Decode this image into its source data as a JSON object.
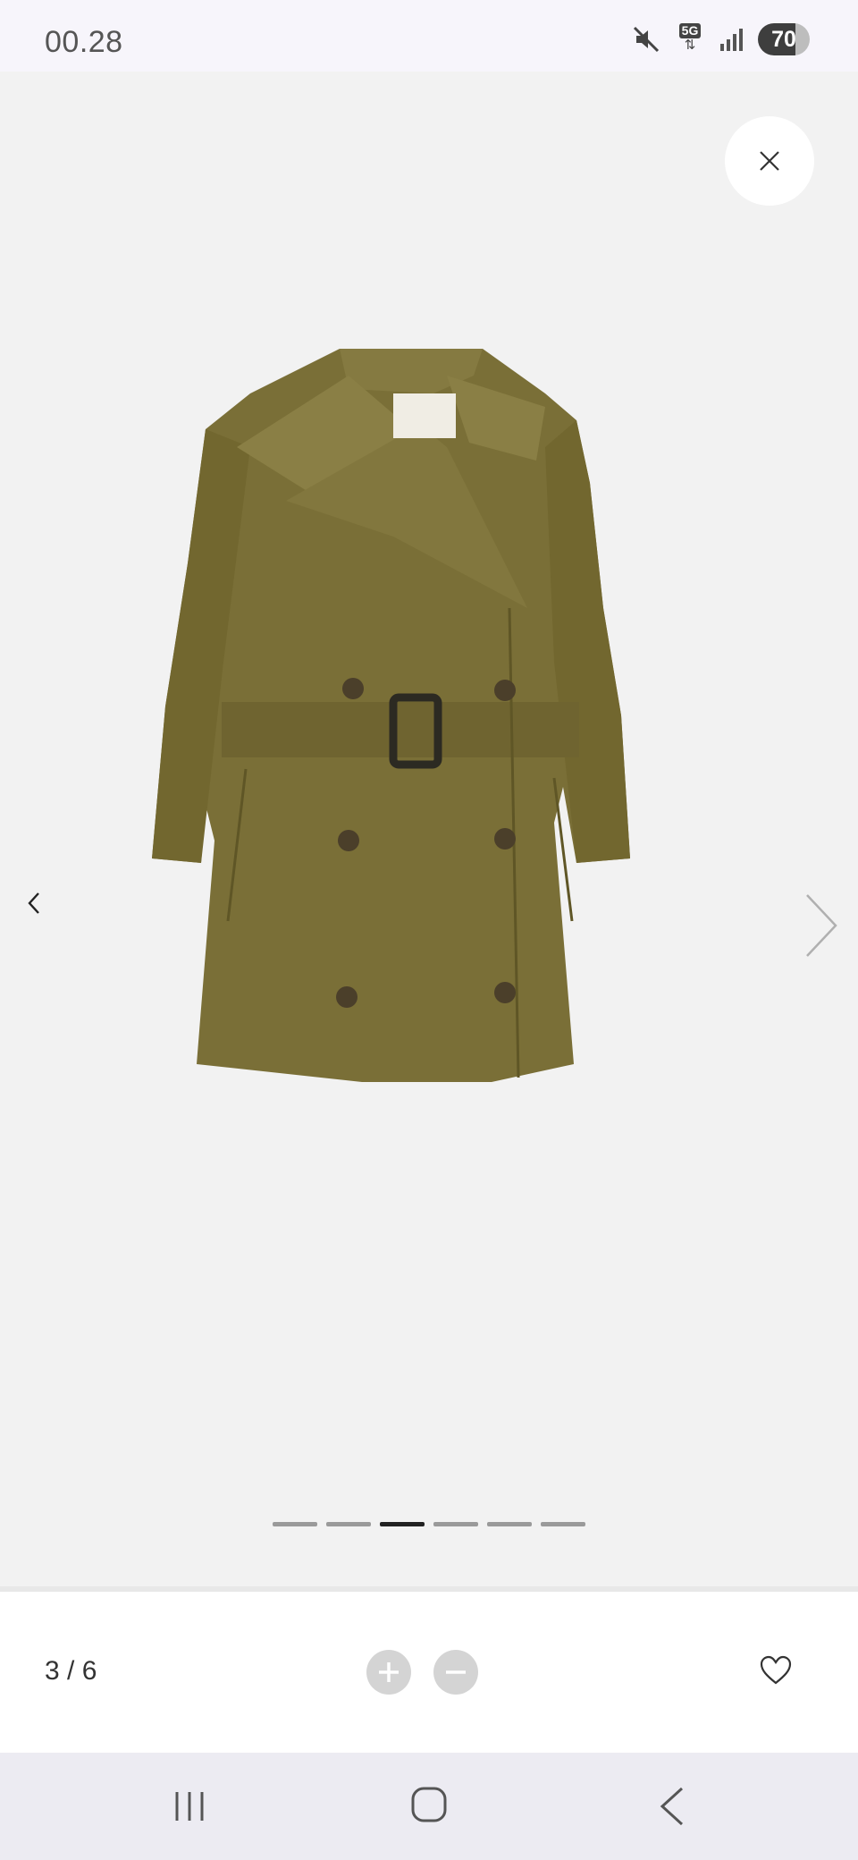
{
  "status_bar": {
    "time": "00.28",
    "network": "5G",
    "battery": "70",
    "icons": [
      "mute-icon",
      "5g-data-icon",
      "signal-icon",
      "battery-icon"
    ]
  },
  "gallery": {
    "image": "olive trench coat",
    "slide_count": 6,
    "active_slide": 3
  },
  "toolbar": {
    "counter": "3 / 6",
    "icons": [
      "zoom-in-icon",
      "zoom-out-icon",
      "heart-icon"
    ]
  },
  "navigation": {
    "icons": [
      "recent-apps-icon",
      "home-icon",
      "back-icon"
    ]
  },
  "colors": {
    "gallery_bg": "#f2f2f2",
    "coat": "#7a6f37",
    "active_dot": "#222222",
    "inactive_dot": "#9a9a9a"
  }
}
